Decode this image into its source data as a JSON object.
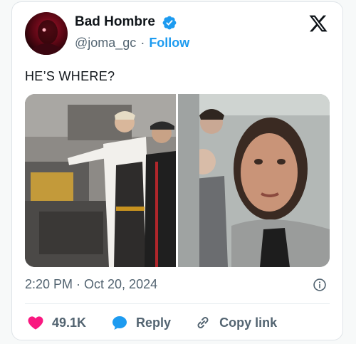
{
  "author": {
    "display_name": "Bad Hombre",
    "handle": "@joma_gc",
    "follow_label": "Follow",
    "verified": true
  },
  "tweet": {
    "text": "HE’S WHERE?",
    "timestamp": "2:20 PM · Oct 20, 2024"
  },
  "media": {
    "panels": [
      {
        "description_name": "left-photo-fryer"
      },
      {
        "description_name": "right-photo-portrait"
      }
    ]
  },
  "actions": {
    "like_count": "49.1K",
    "reply_label": "Reply",
    "copy_link_label": "Copy link"
  },
  "icons": {
    "verified": "verified-badge-icon",
    "platform": "x-logo-icon",
    "info": "info-icon",
    "like": "heart-icon",
    "reply": "speech-bubble-icon",
    "copy": "link-icon"
  },
  "colors": {
    "accent": "#1d9bf0",
    "like": "#f91880",
    "text_secondary": "#536471"
  }
}
